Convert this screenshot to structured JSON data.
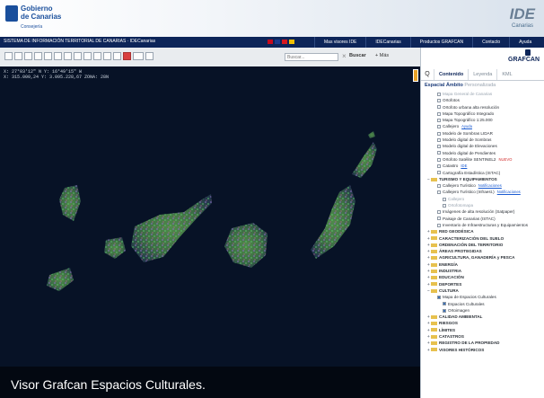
{
  "header": {
    "logo_line1": "Gobierno",
    "logo_line2": "de Canarias",
    "logo_sub": "Consejería",
    "ide_logo": "IDE",
    "ide_sub": "Canarias"
  },
  "menubar": {
    "app_title": "SISTEMA DE INFORMACIÓN TERRITORIAL DE CANARIAS · IDECanarias",
    "items": [
      "Mas visores IDE",
      "IDECanarias",
      "Productos GRAFCAN",
      "Contacto",
      "Ayuda"
    ],
    "flag_colors": [
      "#c60b1e",
      "#1a3a8c",
      "#d71920",
      "#00843d",
      "#1c3f94",
      "#f1bf00"
    ]
  },
  "toolbar": {
    "search_placeholder": "Buscar...",
    "search_label": "Buscar",
    "more_label": "+ Más",
    "clear_icon": "×",
    "tool_icons": [
      "hand-icon",
      "zoom-in-icon",
      "zoom-out-icon",
      "info-icon",
      "measure-icon",
      "area-icon",
      "draw-icon",
      "print-icon",
      "home-icon",
      "back-icon",
      "forward-icon",
      "layers-icon",
      "pdf-icon",
      "3d-icon",
      "help-icon"
    ]
  },
  "map": {
    "coords_line1": "X: 27°03'12\" N  Y: 16°49'15\" W",
    "coords_line2": "X: 315.000,24  Y: 3.095.228,67  ZONA: 28N"
  },
  "caption": "Visor Grafcan Espacios Culturales.",
  "panel": {
    "brand": "GRAFCAN",
    "search_tab_icon": "Q",
    "tabs": [
      {
        "label": "Contenido",
        "active": true
      },
      {
        "label": "Leyenda",
        "active": false
      },
      {
        "label": "KML",
        "active": false
      }
    ],
    "subheader_left": "Espacial",
    "subheader_mid": "Ámbito",
    "subheader_right": "Personalizada",
    "tree": [
      {
        "label": "Mapa General de Canarias",
        "level": "l2",
        "type": "box",
        "dim": true
      },
      {
        "label": "Ortofotos",
        "level": "l2",
        "type": "box"
      },
      {
        "label": "Ortofoto urbana alta resolución",
        "level": "l2",
        "type": "box"
      },
      {
        "label": "Mapa Topográfico Integrado",
        "level": "l2",
        "type": "box"
      },
      {
        "label": "Mapa Topográfico 1:25.000",
        "level": "l2",
        "type": "box"
      },
      {
        "label": "Callejero",
        "level": "l2",
        "type": "box",
        "tag": "Ayuda",
        "tag_color": "blue"
      },
      {
        "label": "Modelo de Sombras LIDAR",
        "level": "l2",
        "type": "box"
      },
      {
        "label": "Modelo digital de Sombras",
        "level": "l2",
        "type": "box"
      },
      {
        "label": "Modelo digital de Elevaciones",
        "level": "l2",
        "type": "box"
      },
      {
        "label": "Modelo digital de Pendientes",
        "level": "l2",
        "type": "box"
      },
      {
        "label": "Ortofoto Satélite SENTINEL2",
        "level": "l2",
        "type": "box",
        "tag": "NUEVO",
        "tag_color": "red"
      },
      {
        "label": "Catastro",
        "level": "l2",
        "type": "box",
        "tag": "IDE",
        "tag_color": "blue"
      },
      {
        "label": "Cartografía Estadística (ISTAC)",
        "level": "l2",
        "type": "box"
      },
      {
        "label": "TURISMO Y EQUIPAMIENTOS",
        "level": "l1",
        "type": "folder",
        "exp": "−",
        "top": true
      },
      {
        "label": "Callejero Turístico",
        "level": "l2",
        "type": "box",
        "tag": "Notificaciones",
        "tag_color": "blue"
      },
      {
        "label": "Callejero Turístico (Infraest.)",
        "level": "l2",
        "type": "box",
        "tag": "Notificaciones",
        "tag_color": "blue"
      },
      {
        "label": "Callejero",
        "level": "l3",
        "type": "box",
        "dim": true
      },
      {
        "label": "Ortofotomapa",
        "level": "l3",
        "type": "box",
        "dim": true
      },
      {
        "label": "Imágenes de alta resolución (Satpaper)",
        "level": "l2",
        "type": "box"
      },
      {
        "label": "Paisaje de Canarias (ISTAC)",
        "level": "l2",
        "type": "box"
      },
      {
        "label": "Inventario de Infraestructuras y Equipamientos",
        "level": "l2",
        "type": "box"
      },
      {
        "label": "RED GEODÉSICA",
        "level": "l1",
        "type": "folder",
        "exp": "+",
        "top": true
      },
      {
        "label": "CARACTERIZACIÓN DEL SUELO",
        "level": "l1",
        "type": "folder",
        "exp": "+",
        "top": true
      },
      {
        "label": "ORDENACIÓN DEL TERRITORIO",
        "level": "l1",
        "type": "folder",
        "exp": "+",
        "top": true
      },
      {
        "label": "ÁREAS PROTEGIDAS",
        "level": "l1",
        "type": "folder",
        "exp": "+",
        "top": true
      },
      {
        "label": "AGRICULTURA, GANADERÍA y PESCA",
        "level": "l1",
        "type": "folder",
        "exp": "+",
        "top": true
      },
      {
        "label": "ENERGÍA",
        "level": "l1",
        "type": "folder",
        "exp": "+",
        "top": true
      },
      {
        "label": "INDUSTRIA",
        "level": "l1",
        "type": "folder",
        "exp": "+",
        "top": true
      },
      {
        "label": "EDUCACIÓN",
        "level": "l1",
        "type": "folder",
        "exp": "+",
        "top": true
      },
      {
        "label": "DEPORTES",
        "level": "l1",
        "type": "folder",
        "exp": "+",
        "top": true
      },
      {
        "label": "CULTURA",
        "level": "l1",
        "type": "folder",
        "exp": "−",
        "top": true
      },
      {
        "label": "Mapa de Espacios Culturales",
        "level": "l2",
        "type": "box",
        "on": true
      },
      {
        "label": "Espacios Culturales",
        "level": "l3",
        "type": "box",
        "on": true
      },
      {
        "label": "Ortoimagen",
        "level": "l3",
        "type": "box",
        "on": true
      },
      {
        "label": "CALIDAD AMBIENTAL",
        "level": "l1",
        "type": "folder",
        "exp": "+",
        "top": true
      },
      {
        "label": "RIESGOS",
        "level": "l1",
        "type": "folder",
        "exp": "+",
        "top": true
      },
      {
        "label": "LÍMITES",
        "level": "l1",
        "type": "folder",
        "exp": "+",
        "top": true
      },
      {
        "label": "CATASTROS",
        "level": "l1",
        "type": "folder",
        "exp": "+",
        "top": true
      },
      {
        "label": "REGISTRO DE LA PROPIEDAD",
        "level": "l1",
        "type": "folder",
        "exp": "+",
        "top": true
      },
      {
        "label": "VISORES HISTÓRICOS",
        "level": "l1",
        "type": "folder",
        "exp": "+",
        "top": true
      }
    ]
  }
}
